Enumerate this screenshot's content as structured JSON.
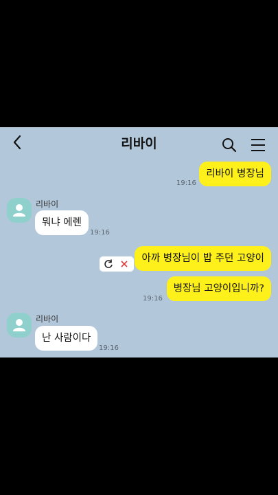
{
  "header": {
    "title": "리바이"
  },
  "icons": {
    "back": "chevron-left-icon",
    "search": "search-icon",
    "menu": "hamburger-menu-icon",
    "avatar": "default-person-icon",
    "retry": "refresh-icon",
    "cancel": "close-icon"
  },
  "messages": [
    {
      "sender": "me",
      "text": "리바이 병장님",
      "time": "19:16"
    },
    {
      "sender": "other",
      "name": "리바이",
      "text": "뭐냐 에렌",
      "time": "19:16"
    },
    {
      "sender": "me",
      "text": "아까 병장님이 밥 주던 고양이",
      "status": "failed"
    },
    {
      "sender": "me",
      "text": "병장님 고양이입니까?",
      "time": "19:16"
    },
    {
      "sender": "other",
      "name": "리바이",
      "text": "난 사람이다",
      "time": "19:16"
    }
  ],
  "colors": {
    "chat_background": "#b2c7d9",
    "my_bubble": "#fef01b",
    "other_bubble": "#ffffff",
    "avatar": "#8fd0cd",
    "cancel_x": "#e0353b",
    "letterbox": "#000000"
  }
}
